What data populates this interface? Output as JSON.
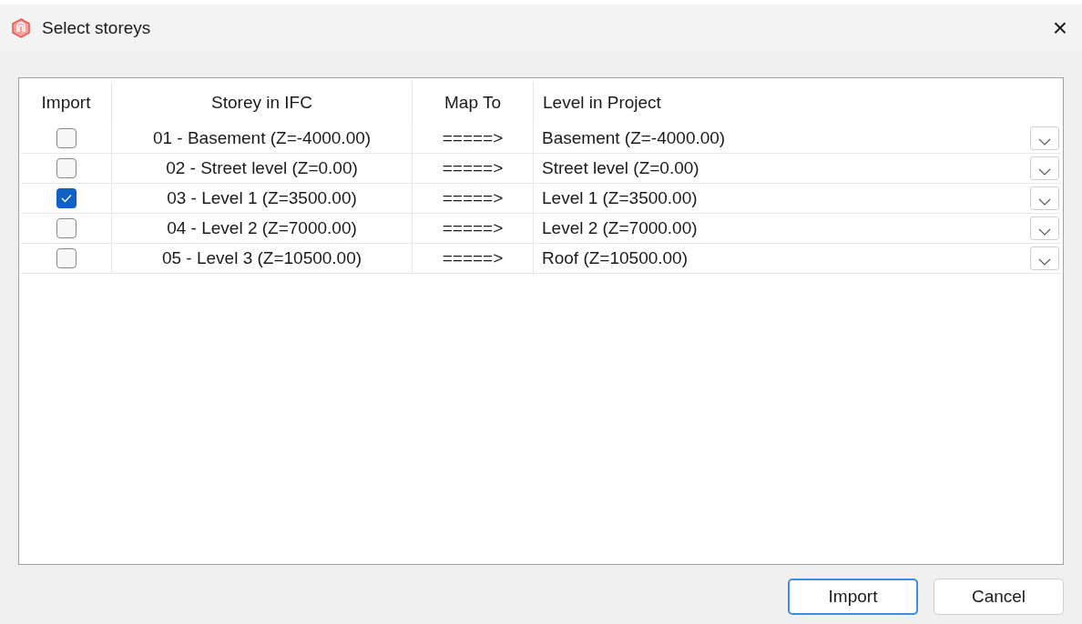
{
  "window": {
    "title": "Select storeys",
    "close": "×"
  },
  "table": {
    "columns": [
      "Import",
      "Storey in IFC",
      "Map To",
      "Level in Project"
    ],
    "rows": [
      {
        "checked": false,
        "storey": "01 - Basement (Z=-4000.00)",
        "map": "=====>",
        "level": "Basement (Z=-4000.00)"
      },
      {
        "checked": false,
        "storey": "02 - Street level (Z=0.00)",
        "map": "=====>",
        "level": "Street level (Z=0.00)"
      },
      {
        "checked": true,
        "storey": "03 - Level 1 (Z=3500.00)",
        "map": "=====>",
        "level": "Level 1 (Z=3500.00)"
      },
      {
        "checked": false,
        "storey": "04 - Level 2 (Z=7000.00)",
        "map": "=====>",
        "level": "Level 2 (Z=7000.00)"
      },
      {
        "checked": false,
        "storey": "05 - Level 3 (Z=10500.00)",
        "map": "=====>",
        "level": "Roof (Z=10500.00)"
      }
    ]
  },
  "buttons": [
    {
      "label": "Import",
      "default": true
    },
    {
      "label": "Cancel",
      "default": false
    }
  ]
}
